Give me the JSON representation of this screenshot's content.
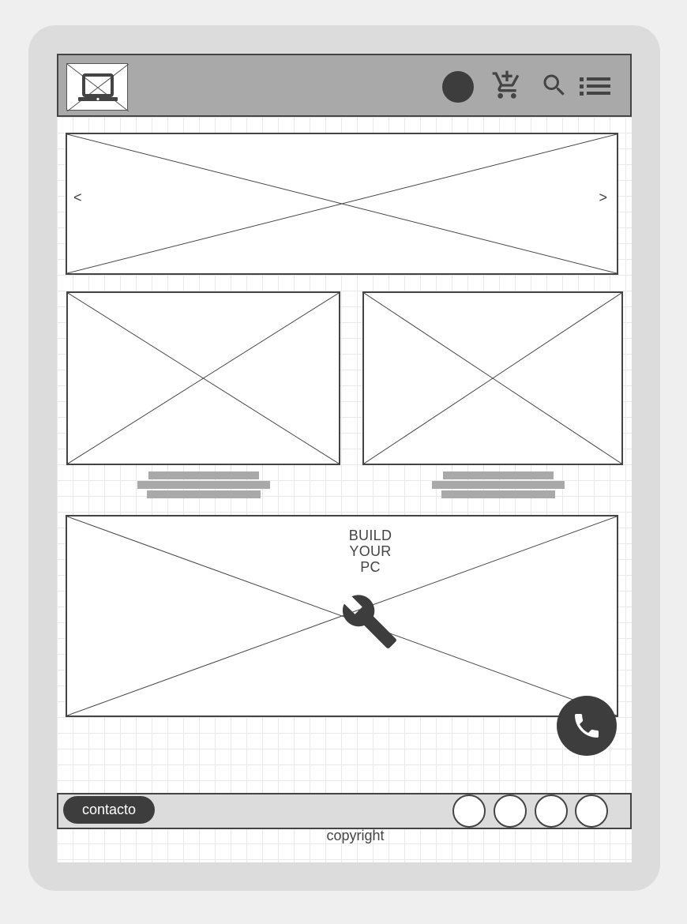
{
  "header": {
    "logo_icon": "laptop-icon",
    "icons": [
      "user-avatar",
      "add-to-cart-icon",
      "search-icon",
      "menu-list-icon"
    ]
  },
  "carousel": {
    "prev_label": "<",
    "next_label": ">"
  },
  "promo": {
    "title_lines": [
      "BUILD",
      "YOUR",
      "PC"
    ],
    "icon": "wrench-icon"
  },
  "contact_fab": {
    "icon": "phone-icon"
  },
  "footer": {
    "contact_label": "contacto",
    "social_count": 4,
    "copyright": "copyright"
  },
  "colors": {
    "dark": "#3d3d3d",
    "header_bg": "#a9a9a9",
    "footer_bg": "#dcdcdc"
  }
}
